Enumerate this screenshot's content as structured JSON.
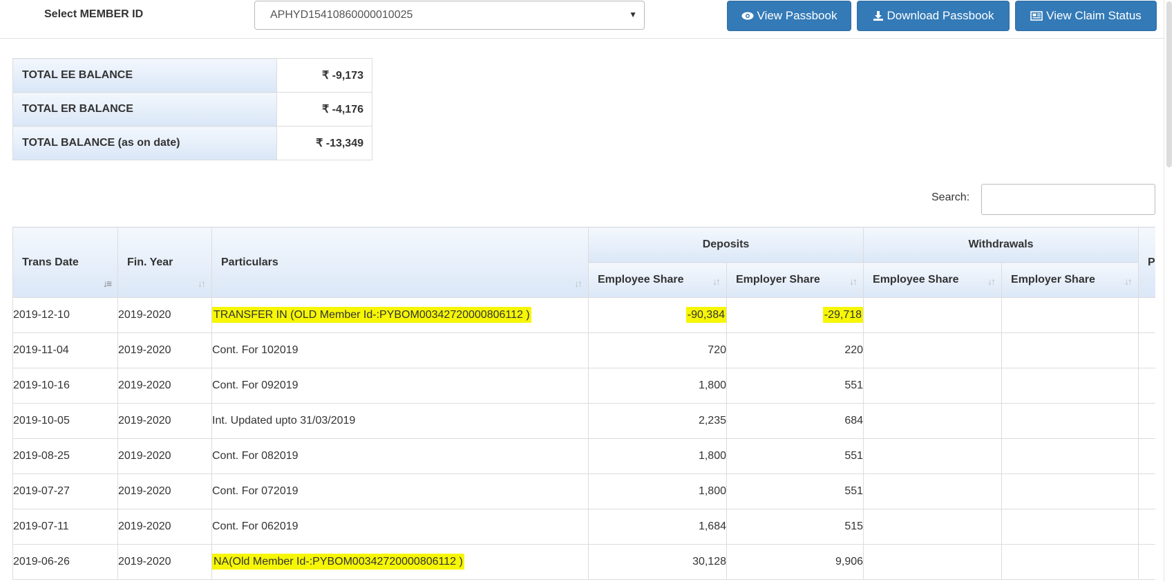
{
  "member_select": {
    "label": "Select MEMBER ID",
    "value": "APHYD15410860000010025"
  },
  "buttons": {
    "view_passbook": "View Passbook",
    "download_passbook": "Download Passbook",
    "view_claim_status": "View Claim Status"
  },
  "summary": [
    {
      "label": "TOTAL EE BALANCE",
      "value": "₹ -9,173"
    },
    {
      "label": "TOTAL ER BALANCE",
      "value": "₹ -4,176"
    },
    {
      "label": "TOTAL BALANCE (as on date)",
      "value": "₹ -13,349"
    }
  ],
  "search": {
    "label": "Search:",
    "value": ""
  },
  "table": {
    "headers": {
      "trans_date": "Trans Date",
      "fin_year": "Fin. Year",
      "particulars": "Particulars",
      "deposits": "Deposits",
      "withdrawals": "Withdrawals",
      "pension": "Pe",
      "dep_ee": "Employee Share",
      "dep_er": "Employer Share",
      "wd_ee": "Employee Share",
      "wd_er": "Employer Share"
    },
    "rows": [
      {
        "date": "2019-12-10",
        "year": "2019-2020",
        "particulars": "TRANSFER IN (OLD Member Id-:PYBOM00342720000806112 )",
        "dep_ee": "-90,384",
        "dep_er": "-29,718",
        "wd_ee": "",
        "wd_er": "",
        "highlight": true
      },
      {
        "date": "2019-11-04",
        "year": "2019-2020",
        "particulars": "Cont. For 102019",
        "dep_ee": "720",
        "dep_er": "220",
        "wd_ee": "",
        "wd_er": "",
        "highlight": false
      },
      {
        "date": "2019-10-16",
        "year": "2019-2020",
        "particulars": "Cont. For 092019",
        "dep_ee": "1,800",
        "dep_er": "551",
        "wd_ee": "",
        "wd_er": "",
        "highlight": false
      },
      {
        "date": "2019-10-05",
        "year": "2019-2020",
        "particulars": "Int. Updated upto 31/03/2019",
        "dep_ee": "2,235",
        "dep_er": "684",
        "wd_ee": "",
        "wd_er": "",
        "highlight": false
      },
      {
        "date": "2019-08-25",
        "year": "2019-2020",
        "particulars": "Cont. For 082019",
        "dep_ee": "1,800",
        "dep_er": "551",
        "wd_ee": "",
        "wd_er": "",
        "highlight": false
      },
      {
        "date": "2019-07-27",
        "year": "2019-2020",
        "particulars": "Cont. For 072019",
        "dep_ee": "1,800",
        "dep_er": "551",
        "wd_ee": "",
        "wd_er": "",
        "highlight": false
      },
      {
        "date": "2019-07-11",
        "year": "2019-2020",
        "particulars": "Cont. For 062019",
        "dep_ee": "1,684",
        "dep_er": "515",
        "wd_ee": "",
        "wd_er": "",
        "highlight": false
      },
      {
        "date": "2019-06-26",
        "year": "2019-2020",
        "particulars": "NA(Old Member Id-:PYBOM00342720000806112 )",
        "dep_ee": "30,128",
        "dep_er": "9,906",
        "wd_ee": "",
        "wd_er": "",
        "highlight_particulars_only": true
      }
    ]
  },
  "colors": {
    "button_primary": "#337ab7",
    "highlight": "#f6f605",
    "header_gradient_bottom": "#dbe7f7"
  }
}
